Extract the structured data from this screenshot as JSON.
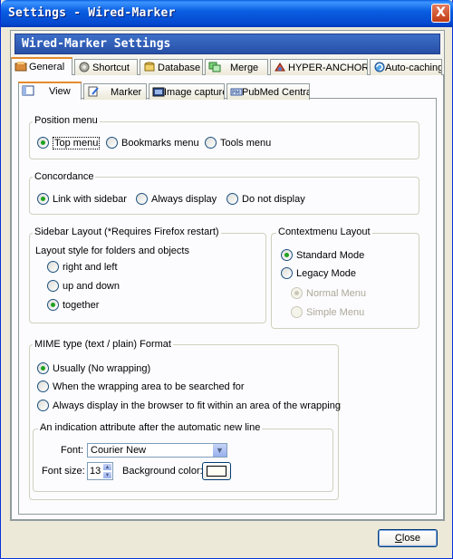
{
  "window": {
    "title": "Settings - Wired-Marker",
    "close_glyph": "X"
  },
  "header": {
    "title": "Wired-Marker Settings"
  },
  "main_tabs": [
    {
      "label": "General",
      "icon": "general-icon"
    },
    {
      "label": "Shortcut",
      "icon": "shortcut-icon"
    },
    {
      "label": "Database",
      "icon": "database-icon"
    },
    {
      "label": "Merge",
      "icon": "merge-icon"
    },
    {
      "label": "HYPER-ANCHOR",
      "icon": "hyper-anchor-icon"
    },
    {
      "label": "Auto-caching",
      "icon": "auto-caching-icon"
    }
  ],
  "sub_tabs": [
    {
      "label": "View",
      "icon": "view-icon"
    },
    {
      "label": "Marker",
      "icon": "marker-icon"
    },
    {
      "label": "Image capture",
      "icon": "image-capture-icon"
    },
    {
      "label": "PubMed Central",
      "icon": "pubmed-icon"
    }
  ],
  "position_menu": {
    "legend": "Position menu",
    "options": [
      "Top menu",
      "Bookmarks menu",
      "Tools menu"
    ],
    "selected": "Top menu"
  },
  "concordance": {
    "legend": "Concordance",
    "options": [
      "Link with sidebar",
      "Always display",
      "Do not display"
    ],
    "selected": "Link with sidebar"
  },
  "sidebar_layout": {
    "legend": "Sidebar Layout (*Requires Firefox restart)",
    "caption": "Layout style for folders and objects",
    "options": [
      "right and left",
      "up and down",
      "together"
    ],
    "selected": "together"
  },
  "contextmenu_layout": {
    "legend": "Contextmenu Layout",
    "options": [
      "Standard Mode",
      "Legacy Mode"
    ],
    "selected": "Standard Mode",
    "sub_options": [
      "Normal Menu",
      "Simple Menu"
    ],
    "sub_selected": "Normal Menu"
  },
  "mime": {
    "legend": "MIME type (text / plain) Format",
    "options": [
      "Usually (No wrapping)",
      "When the wrapping area to be searched for",
      "Always display in the browser to fit within an area of the wrapping"
    ],
    "selected": "Usually (No wrapping)"
  },
  "indication": {
    "legend": "An indication attribute after the automatic new line",
    "font_label": "Font:",
    "font_value": "Courier New",
    "font_size_label": "Font size:",
    "font_size_value": "13",
    "bg_color_label": "Background color:",
    "bg_color": "#fffef5"
  },
  "footer": {
    "close_label": "Close"
  }
}
